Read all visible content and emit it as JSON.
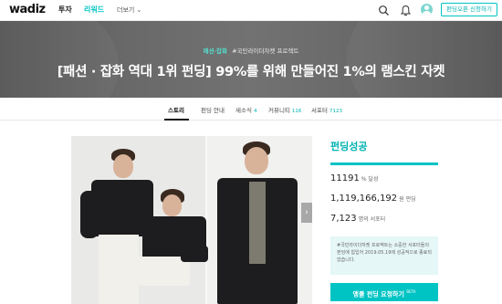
{
  "header": {
    "logo": "wadiz",
    "nav": [
      "투자",
      "리워드"
    ],
    "more": "더보기 ⌄",
    "open_button": "펀딩오픈 신청하기"
  },
  "hero": {
    "category": "패션·잡화",
    "tag": "#국민라이더자켓 프로젝트",
    "title": "[패션 · 잡화 역대 1위 펀딩] 99%를 위해 만들어진 1%의 램스킨 자켓"
  },
  "tabs": [
    {
      "label": "스토리",
      "count": ""
    },
    {
      "label": "펀딩 안내",
      "count": ""
    },
    {
      "label": "새소식",
      "count": "4"
    },
    {
      "label": "커뮤니티",
      "count": "116"
    },
    {
      "label": "서포터",
      "count": "7123"
    }
  ],
  "funding": {
    "status": "펀딩성공",
    "percent": "11191",
    "percent_unit": "% 달성",
    "amount": "1,119,166,192",
    "amount_unit": "원 펀딩",
    "supporters": "7,123",
    "supporters_unit": "명의 서포터",
    "notice": "#국민라이더자켓 프로젝트는 소중한 서포터들의 펀딩에 힘입어 2019.05.19에 성공적으로 종료되었습니다.",
    "cta_label": "앵콜 펀딩 요청하기",
    "cta_badge": "BETA"
  },
  "colors": {
    "accent": "#00c4c4",
    "accent_dark": "#00b2b2"
  },
  "icons": {
    "search": "search-icon",
    "bell": "bell-icon",
    "user": "avatar",
    "next": "chevron-right-icon"
  }
}
